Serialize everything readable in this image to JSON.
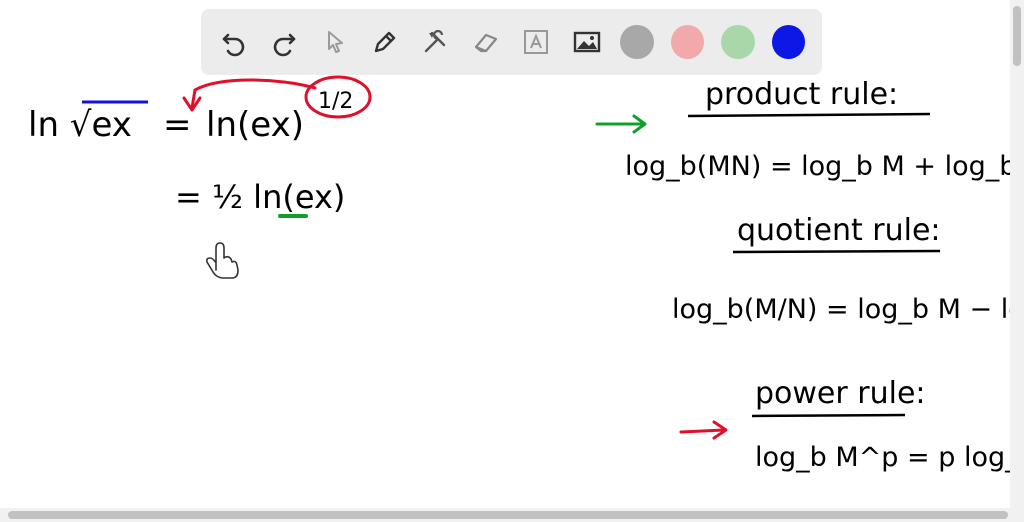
{
  "toolbar": {
    "tools": [
      {
        "name": "undo-icon",
        "interactable": true
      },
      {
        "name": "redo-icon",
        "interactable": true
      },
      {
        "name": "pointer-icon",
        "interactable": true
      },
      {
        "name": "pen-icon",
        "interactable": true
      },
      {
        "name": "tools-icon",
        "interactable": true
      },
      {
        "name": "eraser-icon",
        "interactable": true
      },
      {
        "name": "text-icon",
        "interactable": true
      },
      {
        "name": "image-icon",
        "interactable": true
      }
    ],
    "colors": [
      "#a8a8a8",
      "#f2a9ab",
      "#a9d7a9",
      "#0b18e6"
    ]
  },
  "left_work": {
    "line1_lhs": "ln √ex",
    "line1_eq": "=",
    "line1_rhs": "ln(ex)",
    "exponent": "1/2",
    "line2": "= ½ ln(ex)"
  },
  "rules": {
    "product_title": "product rule:",
    "product_formula": "log_b(MN) = log_b M + log_b N",
    "quotient_title": "quotient rule:",
    "quotient_formula": "log_b(M/N) = log_b M − log_b N",
    "power_title": "power rule:",
    "power_formula": "log_b M^p = p log_b M"
  }
}
